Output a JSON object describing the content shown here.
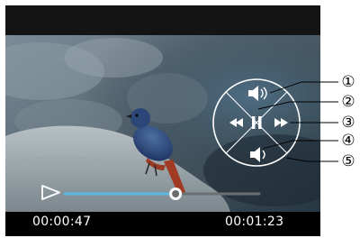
{
  "playback": {
    "current_time": "00:00:47",
    "duration": "00:01:23",
    "progress_fraction": 0.57
  },
  "controls": {
    "icons": [
      "volume-up-icon",
      "pause-icon",
      "rewind-icon",
      "fast-forward-icon",
      "volume-down-icon"
    ],
    "callouts": [
      "①",
      "②",
      "③",
      "④",
      "⑤"
    ]
  },
  "colors": {
    "progress_played": "#5bb8e2",
    "progress_remaining": "#6a6f72",
    "control_stroke": "#ffffff",
    "callout_stroke": "#000000"
  }
}
